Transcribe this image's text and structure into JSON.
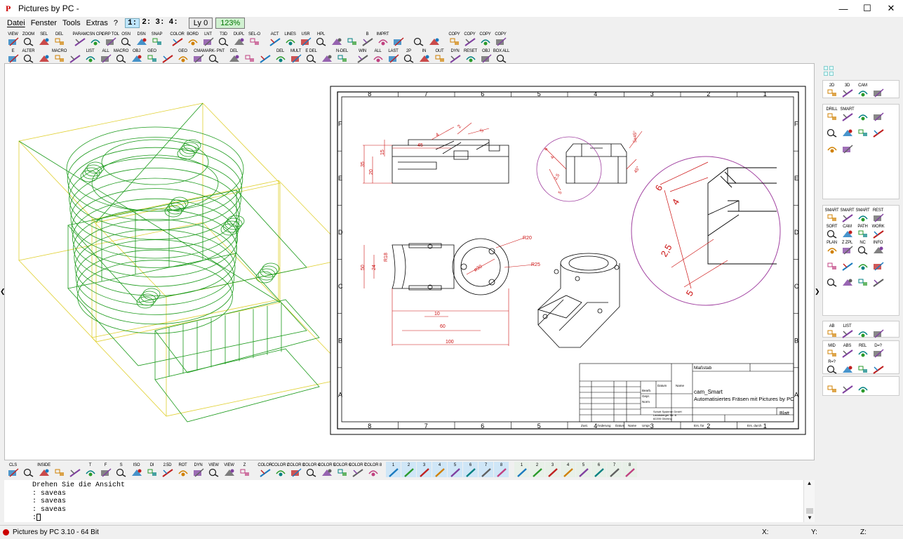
{
  "window": {
    "title": "Pictures by PC -",
    "logo_letter": "P",
    "minimize": "—",
    "maximize": "☐",
    "close": "✕"
  },
  "menu": [
    "Datei",
    "Fenster",
    "Tools",
    "Extras",
    "?"
  ],
  "view_buttons": [
    "1:",
    "2:",
    "3:",
    "4:"
  ],
  "layer": "Ly 0",
  "zoom": "123%",
  "toolbar1": [
    {
      "label": "VIEW",
      "icon": "view-icon"
    },
    {
      "label": "ZOOM",
      "icon": "zoom-icon"
    },
    {
      "label": "SEL",
      "icon": "select-icon"
    },
    {
      "label": "DEL",
      "icon": "delete-icon"
    },
    {
      "label": "PARAM",
      "icon": "param-icon"
    },
    {
      "label": "CSN CPL",
      "icon": "csn-icon"
    },
    {
      "label": "GRP TOL",
      "icon": "grp-icon"
    },
    {
      "label": "OSN",
      "icon": "osn-icon"
    },
    {
      "label": "DSN",
      "icon": "dsn-icon"
    },
    {
      "label": "SNAP",
      "icon": "snap-icon"
    },
    {
      "label": "COLOR",
      "icon": "color-icon"
    },
    {
      "label": "BORD",
      "icon": "border-icon"
    },
    {
      "label": "LNT",
      "icon": "linetype-icon"
    },
    {
      "label": "T3D",
      "icon": "t3d-icon"
    },
    {
      "label": "DUPL",
      "icon": "dupl-icon"
    },
    {
      "label": "SEL-O",
      "icon": "sel-o-icon"
    },
    {
      "label": "ACT",
      "icon": "act-icon"
    },
    {
      "label": "LINES",
      "icon": "lines-icon"
    },
    {
      "label": "USR",
      "icon": "usr-icon"
    },
    {
      "label": "HPL",
      "icon": "hpl-icon"
    },
    {
      "label": "",
      "icon": "fill-icon"
    },
    {
      "label": "",
      "icon": "grid-icon"
    },
    {
      "label": "B",
      "icon": "bold-icon"
    },
    {
      "label": "IMPRT",
      "icon": "import-icon"
    },
    {
      "label": "",
      "icon": "render-icon"
    },
    {
      "label": "",
      "icon": "find-icon"
    },
    {
      "label": "",
      "icon": "undo-icon"
    },
    {
      "label": "COPY",
      "icon": "copy-icon"
    },
    {
      "label": "COPY",
      "icon": "copy-icon"
    },
    {
      "label": "COPY",
      "icon": "copy-icon"
    },
    {
      "label": "COPY",
      "icon": "copy-icon"
    }
  ],
  "toolbar2": [
    {
      "label": "E",
      "icon": "edit-icon"
    },
    {
      "label": "ALTER",
      "icon": "alter-icon"
    },
    {
      "label": "",
      "icon": "move-icon"
    },
    {
      "label": "MACRO",
      "icon": "macro-icon"
    },
    {
      "label": "",
      "icon": "check-icon"
    },
    {
      "label": "LIST",
      "icon": "list-icon"
    },
    {
      "label": "ALL",
      "icon": "all-icon"
    },
    {
      "label": "MACRO",
      "icon": "macro2-icon"
    },
    {
      "label": "OBJ",
      "icon": "obj-icon"
    },
    {
      "label": "GEO",
      "icon": "geo-icon"
    },
    {
      "label": "",
      "icon": "info-icon"
    },
    {
      "label": "GEO",
      "icon": "geo2-icon"
    },
    {
      "label": "CMA",
      "icon": "cma-icon"
    },
    {
      "label": "MARK- PNT",
      "icon": "markpoint-icon"
    },
    {
      "label": "DEL",
      "icon": "del-icon"
    },
    {
      "label": "",
      "icon": "trim-icon"
    },
    {
      "label": "",
      "icon": "cut-icon"
    },
    {
      "label": "DEL",
      "icon": "del2-icon"
    },
    {
      "label": "MULT",
      "icon": "mult-icon"
    },
    {
      "label": "E DEL",
      "icon": "edel-icon"
    },
    {
      "label": "",
      "icon": "erase-icon"
    },
    {
      "label": "N-DEL",
      "icon": "ndel-icon"
    },
    {
      "label": "WIN",
      "icon": "zoom-window-icon"
    },
    {
      "label": "ALL",
      "icon": "zoom-all-icon"
    },
    {
      "label": "LAST",
      "icon": "zoom-last-icon"
    },
    {
      "label": "2P",
      "icon": "zoom-2p-icon"
    },
    {
      "label": "IN",
      "icon": "zoom-in-icon"
    },
    {
      "label": "OUT",
      "icon": "zoom-out-icon"
    },
    {
      "label": "DYN",
      "icon": "zoom-dyn-icon"
    },
    {
      "label": "RESET",
      "icon": "reset-icon"
    },
    {
      "label": "OBJ",
      "icon": "zoom-obj-icon"
    },
    {
      "label": "BOX ALL",
      "icon": "box-all-icon"
    }
  ],
  "drawing": {
    "col_numbers": [
      "8",
      "7",
      "6",
      "5",
      "4",
      "3",
      "2",
      "1"
    ],
    "row_letters": [
      "F",
      "E",
      "D",
      "C",
      "B",
      "A"
    ],
    "dims": {
      "d35": "35",
      "d20": "20",
      "d15": "15",
      "d45": "45",
      "d4": "4",
      "d2": "2",
      "d5": "5",
      "d6": "6",
      "d2_5": "2,5",
      "d5_45": "5x45°",
      "d45deg": "45°",
      "r20": "R20",
      "r25": "R25",
      "d50": "50",
      "d24": "24",
      "r18": "R18",
      "d10": "10",
      "d60": "60",
      "d100": "100",
      "phi30": "ø30"
    },
    "title_block": {
      "massstab": "Maßstab",
      "datum": "Datum",
      "name": "Name",
      "bearb": "Bearb.",
      "gepr": "Gepr.",
      "norm": "Norm",
      "drawing_name": "cam_Smart",
      "description": "Automatisiertes Fräsen mit Pictures by PC",
      "company1": "Schott Systeme GmbH",
      "company2": "Landsberger Str. 8",
      "company3": "82205 Gilching",
      "blatt": "Blatt",
      "zust": "Zust.",
      "aenderung": "Änderung",
      "datum2": "Datum",
      "name2": "Name",
      "urspr": "Urspr.",
      "ers_fuer": "Ers. für",
      "ers_durch": "Ers. durch"
    }
  },
  "right_panel": {
    "g1": [
      "2D",
      "3D",
      "CAM"
    ],
    "g2": [
      "DRILL",
      "SMART"
    ],
    "g3": [
      "SMART",
      "SMART",
      "SMART",
      "REST",
      "SORT",
      "CAM",
      "PATH",
      "WORK",
      "PLAN",
      "Z ZPL",
      "NC",
      "INFO"
    ],
    "g4": [
      "AB",
      "LIST"
    ],
    "g5": [
      "MID",
      "ABS",
      "REL",
      "D=?",
      "R=?"
    ]
  },
  "bottom_toolbar": [
    {
      "label": "CLS",
      "icon": "cls-icon"
    },
    {
      "label": "",
      "icon": "shade-icon"
    },
    {
      "label": "INSIDE",
      "icon": "inside-icon"
    },
    {
      "label": "",
      "icon": "box-icon"
    },
    {
      "label": "",
      "icon": "cube-icon"
    },
    {
      "label": "T",
      "icon": "view-top-icon"
    },
    {
      "label": "F",
      "icon": "view-front-icon"
    },
    {
      "label": "S",
      "icon": "view-side-icon"
    },
    {
      "label": "ISO",
      "icon": "view-iso-icon"
    },
    {
      "label": "DI",
      "icon": "view-di-icon"
    },
    {
      "label": "2.5D",
      "icon": "view-25d-icon"
    },
    {
      "label": "ROT",
      "icon": "rotate-icon"
    },
    {
      "label": "DYN",
      "icon": "dyn-icon"
    },
    {
      "label": "VIEW",
      "icon": "view-save-icon"
    },
    {
      "label": "VIEW",
      "icon": "view-load-icon"
    },
    {
      "label": "Z",
      "icon": "z-icon"
    },
    {
      "label": "COLOR",
      "icon": "color-all-icon"
    },
    {
      "label": "COLOR 2",
      "icon": "color-2-icon"
    },
    {
      "label": "COLOR 3",
      "icon": "color-3-icon"
    },
    {
      "label": "COLOR 4",
      "icon": "color-4-icon"
    },
    {
      "label": "COLOR 5",
      "icon": "color-5-icon"
    },
    {
      "label": "COLOR 6",
      "icon": "color-6-icon"
    },
    {
      "label": "COLOR 7",
      "icon": "color-7-icon"
    },
    {
      "label": "COLOR 8",
      "icon": "color-8-icon"
    }
  ],
  "pen_toolbar_a": [
    "1",
    "2",
    "3",
    "4",
    "5",
    "6",
    "7",
    "8"
  ],
  "pen_toolbar_b": [
    "1",
    "2",
    "3",
    "4",
    "5",
    "6",
    "7",
    "8"
  ],
  "console": {
    "lines": [
      "Drehen Sie die Ansicht",
      ": saveas",
      ": saveas",
      ": saveas",
      ":"
    ]
  },
  "status": {
    "app": "Pictures by PC 3.10 - 64 Bit",
    "x": "X:",
    "y": "Y:",
    "z": "Z:"
  },
  "colors": {
    "wire_green": "#1a9a1a",
    "wire_yellow": "#e0d030",
    "dim_red": "#cc1111",
    "detail_magenta": "#a040a0",
    "accent": "#0078d7"
  }
}
